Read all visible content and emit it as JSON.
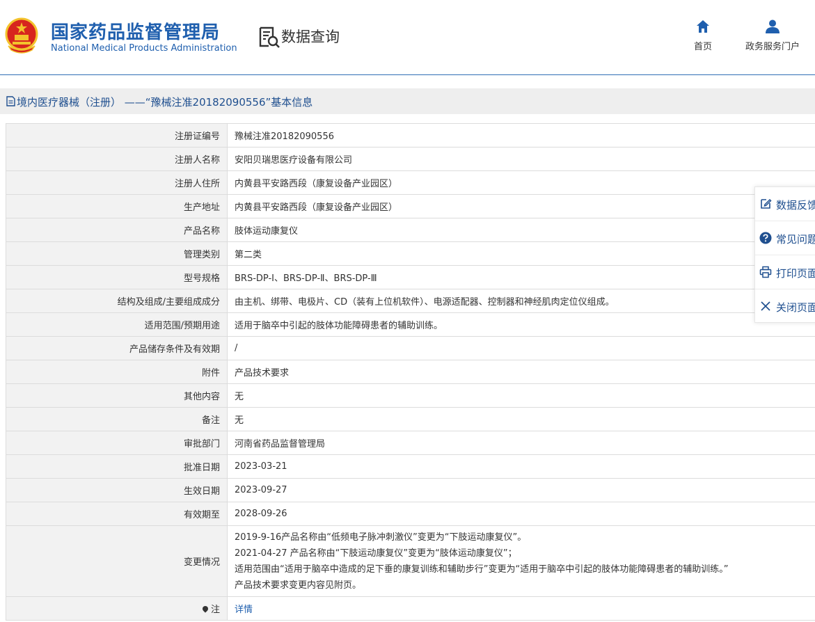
{
  "header": {
    "org_cn": "国家药品监督管理局",
    "org_en": "National Medical Products Administration",
    "page_title": "数据查询",
    "nav": [
      {
        "label": "首页",
        "icon": "home-icon"
      },
      {
        "label": "政务服务门户",
        "icon": "user-icon"
      }
    ]
  },
  "breadcrumb": {
    "text": "境内医疗器械（注册） ——“豫械注准20182090556”基本信息",
    "icon": "document-icon"
  },
  "rows": [
    {
      "label": "注册证编号",
      "value": "豫械注准20182090556"
    },
    {
      "label": "注册人名称",
      "value": "安阳贝瑞思医疗设备有限公司"
    },
    {
      "label": "注册人住所",
      "value": "内黄县平安路西段（康复设备产业园区）"
    },
    {
      "label": "生产地址",
      "value": "内黄县平安路西段（康复设备产业园区）"
    },
    {
      "label": "产品名称",
      "value": "肢体运动康复仪"
    },
    {
      "label": "管理类别",
      "value": "第二类"
    },
    {
      "label": "型号规格",
      "value": "BRS-DP-Ⅰ、BRS-DP-Ⅱ、BRS-DP-Ⅲ"
    },
    {
      "label": "结构及组成/主要组成成分",
      "value": "由主机、绑带、电极片、CD（装有上位机软件）、电源适配器、控制器和神经肌肉定位仪组成。"
    },
    {
      "label": "适用范围/预期用途",
      "value": "适用于脑卒中引起的肢体功能障碍患者的辅助训练。"
    },
    {
      "label": "产品储存条件及有效期",
      "value": "/"
    },
    {
      "label": "附件",
      "value": "产品技术要求"
    },
    {
      "label": "其他内容",
      "value": "无"
    },
    {
      "label": "备注",
      "value": "无"
    },
    {
      "label": "审批部门",
      "value": "河南省药品监督管理局"
    },
    {
      "label": "批准日期",
      "value": "2023-03-21"
    },
    {
      "label": "生效日期",
      "value": "2023-09-27"
    },
    {
      "label": "有效期至",
      "value": "2028-09-26"
    }
  ],
  "change": {
    "label": "变更情况",
    "lines": [
      "2019-9-16产品名称由“低频电子脉冲刺激仪”变更为“下肢运动康复仪”。",
      "2021-04-27 产品名称由“下肢运动康复仪”变更为“肢体运动康复仪”；",
      "适用范围由“适用于脑卒中造成的足下垂的康复训练和辅助步行”变更为“适用于脑卒中引起的肢体功能障碍患者的辅助训练。”",
      "产品技术要求变更内容见附页。"
    ]
  },
  "note": {
    "label": "注",
    "link": "详情"
  },
  "side_panel": [
    {
      "label": "数据反馈",
      "icon": "edit-icon"
    },
    {
      "label": "常见问题",
      "icon": "help-icon"
    },
    {
      "label": "打印页面",
      "icon": "print-icon"
    },
    {
      "label": "关闭页面",
      "icon": "close-icon"
    }
  ],
  "colors": {
    "brand_blue": "#1f5fae",
    "label_bg": "#f2f2f2",
    "emblem_red": "#d7261e",
    "emblem_gold": "#f3c32c"
  }
}
